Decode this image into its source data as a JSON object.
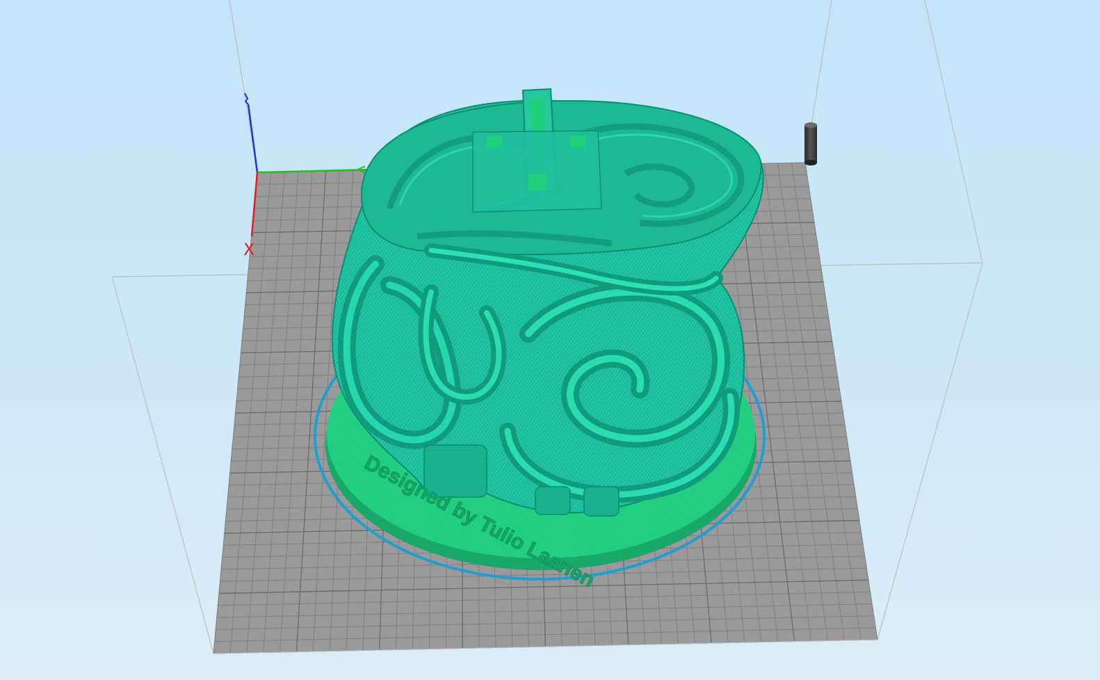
{
  "viewport": {
    "background_top": "#c3e4f8",
    "background_bottom": "#dcedf8",
    "build_plate_color": "#9a9a9a",
    "grid_line_color": "#7d7d7d",
    "build_volume_outline_color": "#bdbdbd"
  },
  "axes": {
    "x_label": "X",
    "x_color": "#e02020",
    "y_color": "#20c020",
    "z_color": "#2030e0"
  },
  "model": {
    "body_color": "#1fc3a0",
    "base_color": "#1ed27e",
    "skirt_color": "#1e9fd0",
    "engraved_text": "Designed by Tulio Laanen"
  },
  "objects": [
    {
      "name": "model",
      "type": "marble-machine-print"
    },
    {
      "name": "prime-tower",
      "color": "#3a3a3a"
    }
  ]
}
